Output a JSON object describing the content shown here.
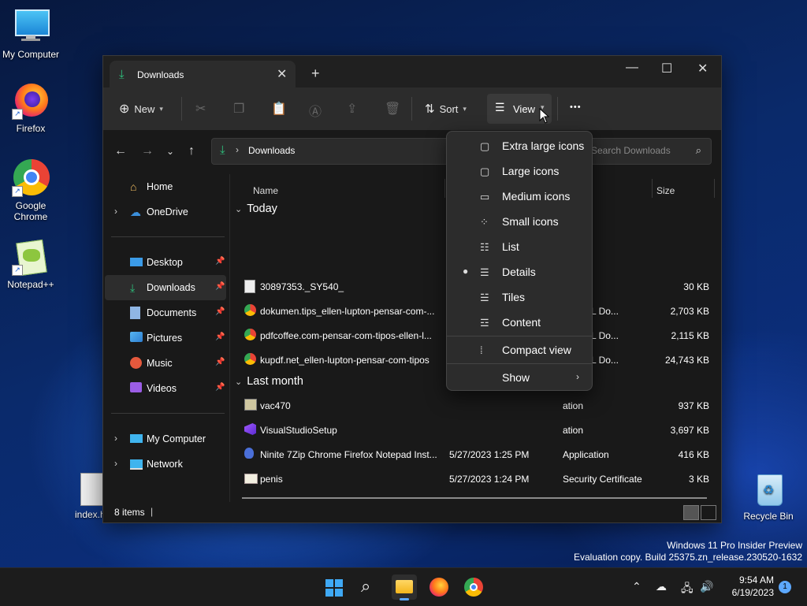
{
  "desktop": {
    "icons": [
      {
        "label": "My Computer",
        "icon": "computer-icon"
      },
      {
        "label": "Firefox",
        "icon": "firefox-icon"
      },
      {
        "label": "Google Chrome",
        "icon": "chrome-icon"
      },
      {
        "label": "Notepad++",
        "icon": "notepadpp-icon"
      },
      {
        "label": "index.ht",
        "icon": "html-file-icon"
      },
      {
        "label": "Recycle Bin",
        "icon": "recycle-bin-icon"
      }
    ],
    "watermark_line1": "Windows 11 Pro Insider Preview",
    "watermark_line2": "Evaluation copy. Build 25375.zn_release.230520-1632"
  },
  "window": {
    "tab_title": "Downloads",
    "toolbar": {
      "new_label": "New",
      "sort_label": "Sort",
      "view_label": "View",
      "more_label": "•••"
    },
    "address": {
      "path": "Downloads"
    },
    "search": {
      "placeholder": "Search Downloads"
    },
    "sidebar": {
      "items": [
        {
          "label": "Home",
          "icon": "home-icon"
        },
        {
          "label": "OneDrive",
          "icon": "onedrive-icon"
        },
        {
          "label": "Desktop",
          "icon": "desktop-icon"
        },
        {
          "label": "Downloads",
          "icon": "downloads-icon"
        },
        {
          "label": "Documents",
          "icon": "documents-icon"
        },
        {
          "label": "Pictures",
          "icon": "pictures-icon"
        },
        {
          "label": "Music",
          "icon": "music-icon"
        },
        {
          "label": "Videos",
          "icon": "videos-icon"
        },
        {
          "label": "My Computer",
          "icon": "computer-icon"
        },
        {
          "label": "Network",
          "icon": "network-icon"
        }
      ]
    },
    "columns": {
      "name": "Name",
      "size": "Size"
    },
    "groups": {
      "today": "Today",
      "last_month": "Last month"
    },
    "files": [
      {
        "name": "30897353._SY540_",
        "date": "",
        "type": "",
        "size": "30 KB",
        "icon": "image-file-icon"
      },
      {
        "name": "dokumen.tips_ellen-lupton-pensar-com-...",
        "date": "",
        "type": "e HTML Do...",
        "size": "2,703 KB",
        "icon": "chrome-html-icon"
      },
      {
        "name": "pdfcoffee.com-pensar-com-tipos-ellen-l...",
        "date": "",
        "type": "e HTML Do...",
        "size": "2,115 KB",
        "icon": "chrome-html-icon"
      },
      {
        "name": "kupdf.net_ellen-lupton-pensar-com-tipos",
        "date": "",
        "type": "e HTML Do...",
        "size": "24,743 KB",
        "icon": "chrome-html-icon"
      },
      {
        "name": "vac470",
        "date": "",
        "type": "ation",
        "size": "937 KB",
        "icon": "app-icon"
      },
      {
        "name": "VisualStudioSetup",
        "date": "",
        "type": "ation",
        "size": "3,697 KB",
        "icon": "visual-studio-icon"
      },
      {
        "name": "Ninite 7Zip Chrome Firefox Notepad Inst...",
        "date": "5/27/2023 1:25 PM",
        "type": "Application",
        "size": "416 KB",
        "icon": "ninite-icon"
      },
      {
        "name": "penis",
        "date": "5/27/2023 1:24 PM",
        "type": "Security Certificate",
        "size": "3 KB",
        "icon": "certificate-icon"
      }
    ],
    "status": {
      "count": "8 items",
      "cursor": "|"
    }
  },
  "view_menu": {
    "items": [
      {
        "label": "Extra large icons",
        "icon": "extra-large-icons-icon",
        "selected": false
      },
      {
        "label": "Large icons",
        "icon": "large-icons-icon",
        "selected": false
      },
      {
        "label": "Medium icons",
        "icon": "medium-icons-icon",
        "selected": false
      },
      {
        "label": "Small icons",
        "icon": "small-icons-icon",
        "selected": false
      },
      {
        "label": "List",
        "icon": "list-icon",
        "selected": false
      },
      {
        "label": "Details",
        "icon": "details-icon",
        "selected": true
      },
      {
        "label": "Tiles",
        "icon": "tiles-icon",
        "selected": false
      },
      {
        "label": "Content",
        "icon": "content-icon",
        "selected": false
      }
    ],
    "compact_label": "Compact view",
    "show_label": "Show"
  },
  "taskbar": {
    "time": "9:54 AM",
    "date": "6/19/2023",
    "notification_count": "1"
  }
}
